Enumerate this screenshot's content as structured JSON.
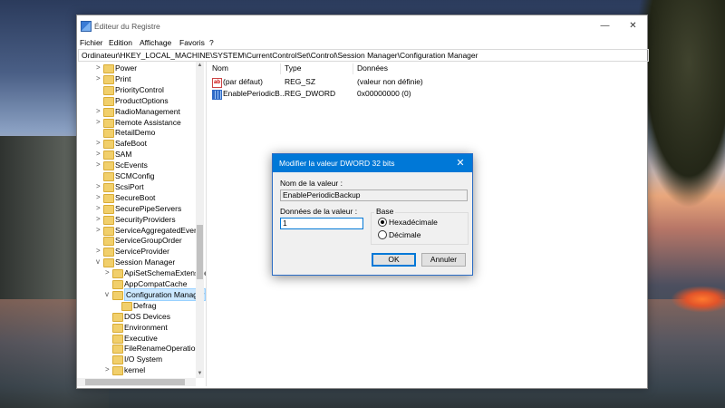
{
  "window": {
    "title": "Éditeur du Registre",
    "controls": {
      "minimize": "—",
      "maximize": "☐",
      "close": "✕"
    }
  },
  "menu": [
    "Fichier",
    "Edition",
    "Affichage",
    "Favoris",
    "?"
  ],
  "address": "Ordinateur\\HKEY_LOCAL_MACHINE\\SYSTEM\\CurrentControlSet\\Control\\Session Manager\\Configuration Manager",
  "tree": [
    {
      "label": "Power",
      "expander": ">"
    },
    {
      "label": "Print",
      "expander": ">"
    },
    {
      "label": "PriorityControl",
      "expander": ""
    },
    {
      "label": "ProductOptions",
      "expander": ""
    },
    {
      "label": "RadioManagement",
      "expander": ">"
    },
    {
      "label": "Remote Assistance",
      "expander": ">"
    },
    {
      "label": "RetailDemo",
      "expander": ""
    },
    {
      "label": "SafeBoot",
      "expander": ">"
    },
    {
      "label": "SAM",
      "expander": ">"
    },
    {
      "label": "ScEvents",
      "expander": ">"
    },
    {
      "label": "SCMConfig",
      "expander": ""
    },
    {
      "label": "ScsiPort",
      "expander": ">"
    },
    {
      "label": "SecureBoot",
      "expander": ">"
    },
    {
      "label": "SecurePipeServers",
      "expander": ">"
    },
    {
      "label": "SecurityProviders",
      "expander": ">"
    },
    {
      "label": "ServiceAggregatedEvents",
      "expander": ">"
    },
    {
      "label": "ServiceGroupOrder",
      "expander": ""
    },
    {
      "label": "ServiceProvider",
      "expander": ">"
    },
    {
      "label": "Session Manager",
      "expander": "v"
    },
    {
      "label": "ApiSetSchemaExtensions",
      "expander": ">"
    },
    {
      "label": "AppCompatCache",
      "expander": ""
    },
    {
      "label": "Configuration Manager",
      "expander": "v",
      "selected": true
    },
    {
      "label": "Defrag",
      "expander": ""
    },
    {
      "label": "DOS Devices",
      "expander": ""
    },
    {
      "label": "Environment",
      "expander": ""
    },
    {
      "label": "Executive",
      "expander": ""
    },
    {
      "label": "FileRenameOperations",
      "expander": ""
    },
    {
      "label": "I/O System",
      "expander": ""
    },
    {
      "label": "kernel",
      "expander": ">"
    }
  ],
  "list": {
    "columns": {
      "name": "Nom",
      "type": "Type",
      "data": "Données"
    },
    "rows": [
      {
        "name": "(par défaut)",
        "type": "REG_SZ",
        "data": "(valeur non définie)",
        "icon": "string-value-icon"
      },
      {
        "name": "EnablePeriodicB...",
        "type": "REG_DWORD",
        "data": "0x00000000 (0)",
        "icon": "dword-value-icon"
      }
    ]
  },
  "dialog": {
    "title": "Modifier la valeur DWORD 32 bits",
    "close": "✕",
    "name_label": "Nom de la valeur :",
    "name_value": "EnablePeriodicBackup",
    "data_label": "Données de la valeur :",
    "data_value": "1",
    "base_label": "Base",
    "base_options": [
      "Hexadécimale",
      "Décimale"
    ],
    "base_selected": "Hexadécimale",
    "ok": "OK",
    "cancel": "Annuler"
  }
}
